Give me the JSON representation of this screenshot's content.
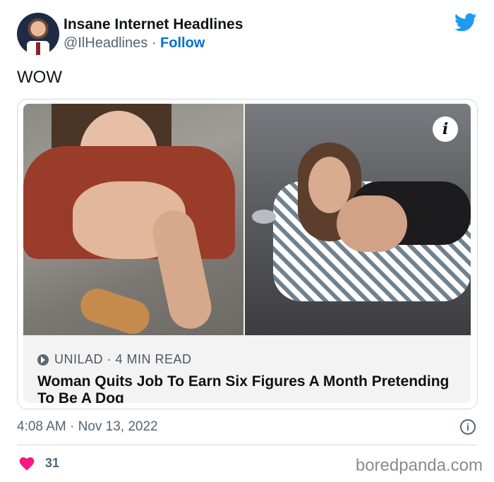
{
  "tweet": {
    "author_name": "Insane Internet Headlines",
    "handle": "@IlHeadlines",
    "separator": "·",
    "follow_label": "Follow",
    "text": "WOW",
    "timestamp": "4:08 AM · Nov 13, 2022",
    "like_count": "31"
  },
  "card": {
    "source": "UNILAD · 4 MIN READ",
    "headline": "Woman Quits Job To Earn Six Figures A Month Pretending To Be A Dog",
    "info_glyph": "i"
  },
  "watermark": "boredpanda.com",
  "icons": {
    "brand": "twitter-bird-icon",
    "like": "heart-icon",
    "info": "info-icon"
  },
  "colors": {
    "twitter_blue": "#1d9bf0",
    "follow_blue": "#006fd6",
    "heart": "#f91880",
    "muted_text": "#536471"
  }
}
